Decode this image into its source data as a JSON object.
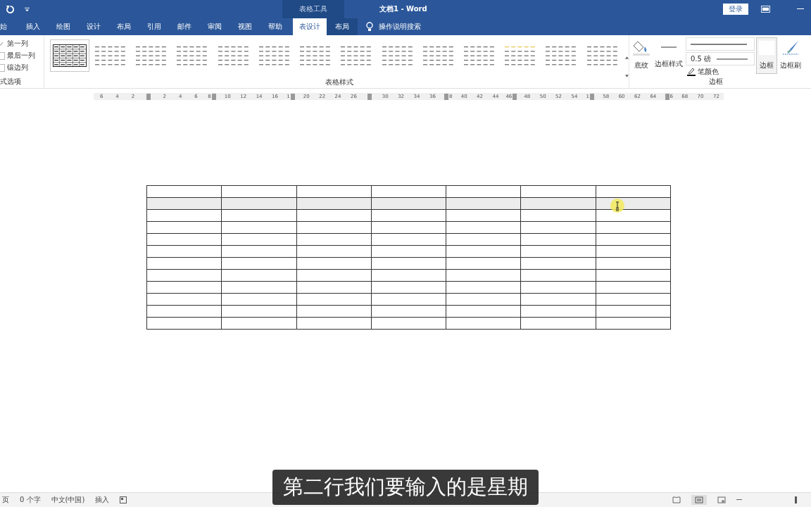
{
  "title_bar": {
    "title": "文档1  -  Word",
    "context_label": "表格工具",
    "login": "登录"
  },
  "tabs": [
    {
      "label": "始",
      "selected": false,
      "context": false
    },
    {
      "label": "插入",
      "selected": false,
      "context": false
    },
    {
      "label": "绘图",
      "selected": false,
      "context": false
    },
    {
      "label": "设计",
      "selected": false,
      "context": false
    },
    {
      "label": "布局",
      "selected": false,
      "context": false
    },
    {
      "label": "引用",
      "selected": false,
      "context": false
    },
    {
      "label": "邮件",
      "selected": false,
      "context": false
    },
    {
      "label": "审阅",
      "selected": false,
      "context": false
    },
    {
      "label": "视图",
      "selected": false,
      "context": false
    },
    {
      "label": "帮助",
      "selected": false,
      "context": false
    },
    {
      "label": "表设计",
      "selected": true,
      "context": true
    },
    {
      "label": "布局",
      "selected": false,
      "context": true
    }
  ],
  "tell_me": "操作说明搜索",
  "options": {
    "group_label": "式选项",
    "items": [
      {
        "label": "第一列",
        "checked": true
      },
      {
        "label": "最后一列",
        "checked": false
      },
      {
        "label": "镶边列",
        "checked": false
      }
    ]
  },
  "styles": {
    "group_label": "表格样式",
    "items": [
      {
        "selected": true
      },
      {
        "selected": false
      },
      {
        "selected": false
      },
      {
        "selected": false
      },
      {
        "selected": false
      },
      {
        "selected": false
      },
      {
        "selected": false
      },
      {
        "selected": false
      },
      {
        "selected": false
      },
      {
        "selected": false
      },
      {
        "selected": false
      },
      {
        "selected": false
      },
      {
        "selected": false
      },
      {
        "selected": false
      }
    ]
  },
  "shading": {
    "label": "底纹"
  },
  "borders": {
    "group_label": "边框",
    "style_label": "边框样式",
    "weight": "0.5 磅",
    "pen_color": "笔颜色",
    "border_button": "边框",
    "painter": "边框刷"
  },
  "ruler": [
    {
      "kind": "num",
      "text": "6"
    },
    {
      "kind": "num",
      "text": "4"
    },
    {
      "kind": "num",
      "text": "2"
    },
    {
      "kind": "marker"
    },
    {
      "kind": "num",
      "text": "2"
    },
    {
      "kind": "num",
      "text": "4"
    },
    {
      "kind": "num",
      "text": "6"
    },
    {
      "kind": "num_marker",
      "text": "8"
    },
    {
      "kind": "num",
      "text": "10"
    },
    {
      "kind": "num",
      "text": "12"
    },
    {
      "kind": "num",
      "text": "14"
    },
    {
      "kind": "num",
      "text": "16"
    },
    {
      "kind": "num_marker",
      "text": "1"
    },
    {
      "kind": "num",
      "text": "20"
    },
    {
      "kind": "num",
      "text": "22"
    },
    {
      "kind": "num",
      "text": "24"
    },
    {
      "kind": "num",
      "text": "26"
    },
    {
      "kind": "marker"
    },
    {
      "kind": "num",
      "text": "30"
    },
    {
      "kind": "num",
      "text": "32"
    },
    {
      "kind": "num",
      "text": "34"
    },
    {
      "kind": "num",
      "text": "36"
    },
    {
      "kind": "marker_num",
      "text": "8"
    },
    {
      "kind": "num",
      "text": "40"
    },
    {
      "kind": "num",
      "text": "42"
    },
    {
      "kind": "num",
      "text": "44"
    },
    {
      "kind": "num_marker",
      "text": "46"
    },
    {
      "kind": "num",
      "text": "48"
    },
    {
      "kind": "num",
      "text": "50"
    },
    {
      "kind": "num",
      "text": "52"
    },
    {
      "kind": "num",
      "text": "54"
    },
    {
      "kind": "num_marker",
      "text": "1"
    },
    {
      "kind": "num",
      "text": "58"
    },
    {
      "kind": "num",
      "text": "60"
    },
    {
      "kind": "num",
      "text": "62"
    },
    {
      "kind": "num",
      "text": "64"
    },
    {
      "kind": "marker_num",
      "text": "6"
    },
    {
      "kind": "num",
      "text": "68"
    },
    {
      "kind": "num",
      "text": "70"
    },
    {
      "kind": "num",
      "text": "72"
    }
  ],
  "table": {
    "rows": [
      {
        "selected": false,
        "cells": [
          {
            "kind": "empty"
          },
          {
            "kind": "empty"
          },
          {
            "kind": "empty"
          },
          {
            "kind": "empty"
          },
          {
            "kind": "empty"
          },
          {
            "kind": "empty"
          },
          {
            "kind": "empty"
          }
        ]
      },
      {
        "selected": true,
        "cells": [
          {
            "kind": "empty"
          },
          {
            "kind": "empty"
          },
          {
            "kind": "empty"
          },
          {
            "kind": "empty"
          },
          {
            "kind": "empty"
          },
          {
            "kind": "empty"
          },
          {
            "kind": "empty"
          }
        ]
      },
      {
        "selected": false,
        "cells": [
          {
            "kind": "empty"
          },
          {
            "kind": "empty"
          },
          {
            "kind": "empty"
          },
          {
            "kind": "empty"
          },
          {
            "kind": "empty"
          },
          {
            "kind": "empty"
          },
          {
            "kind": "empty"
          }
        ]
      },
      {
        "selected": false,
        "cells": [
          {
            "kind": "empty"
          },
          {
            "kind": "empty"
          },
          {
            "kind": "empty"
          },
          {
            "kind": "empty"
          },
          {
            "kind": "empty"
          },
          {
            "kind": "empty"
          },
          {
            "kind": "empty"
          }
        ]
      },
      {
        "selected": false,
        "cells": [
          {
            "kind": "empty"
          },
          {
            "kind": "empty"
          },
          {
            "kind": "empty"
          },
          {
            "kind": "empty"
          },
          {
            "kind": "empty"
          },
          {
            "kind": "empty"
          },
          {
            "kind": "empty"
          }
        ]
      },
      {
        "selected": false,
        "cells": [
          {
            "kind": "empty"
          },
          {
            "kind": "empty"
          },
          {
            "kind": "empty"
          },
          {
            "kind": "empty"
          },
          {
            "kind": "empty"
          },
          {
            "kind": "empty"
          },
          {
            "kind": "empty"
          }
        ]
      },
      {
        "selected": false,
        "cells": [
          {
            "kind": "empty"
          },
          {
            "kind": "empty"
          },
          {
            "kind": "empty"
          },
          {
            "kind": "empty"
          },
          {
            "kind": "empty"
          },
          {
            "kind": "empty"
          },
          {
            "kind": "empty"
          }
        ]
      },
      {
        "selected": false,
        "cells": [
          {
            "kind": "empty"
          },
          {
            "kind": "empty"
          },
          {
            "kind": "empty"
          },
          {
            "kind": "empty"
          },
          {
            "kind": "empty"
          },
          {
            "kind": "empty"
          },
          {
            "kind": "empty"
          }
        ]
      },
      {
        "selected": false,
        "cells": [
          {
            "kind": "empty"
          },
          {
            "kind": "empty"
          },
          {
            "kind": "empty"
          },
          {
            "kind": "empty"
          },
          {
            "kind": "empty"
          },
          {
            "kind": "empty"
          },
          {
            "kind": "empty"
          }
        ]
      },
      {
        "selected": false,
        "cells": [
          {
            "kind": "empty"
          },
          {
            "kind": "empty"
          },
          {
            "kind": "empty"
          },
          {
            "kind": "empty"
          },
          {
            "kind": "empty"
          },
          {
            "kind": "empty"
          },
          {
            "kind": "empty"
          }
        ]
      },
      {
        "selected": false,
        "cells": [
          {
            "kind": "empty"
          },
          {
            "kind": "empty"
          },
          {
            "kind": "empty"
          },
          {
            "kind": "empty"
          },
          {
            "kind": "empty"
          },
          {
            "kind": "empty"
          },
          {
            "kind": "empty"
          }
        ]
      },
      {
        "selected": false,
        "cells": [
          {
            "kind": "empty"
          },
          {
            "kind": "empty"
          },
          {
            "kind": "empty"
          },
          {
            "kind": "empty"
          },
          {
            "kind": "empty"
          },
          {
            "kind": "empty"
          },
          {
            "kind": "empty"
          }
        ]
      }
    ]
  },
  "caption": "第二行我们要输入的是星期",
  "status_bar": {
    "page": "页",
    "words": "0 个字",
    "language": "中文(中国)",
    "mode": "插入"
  }
}
